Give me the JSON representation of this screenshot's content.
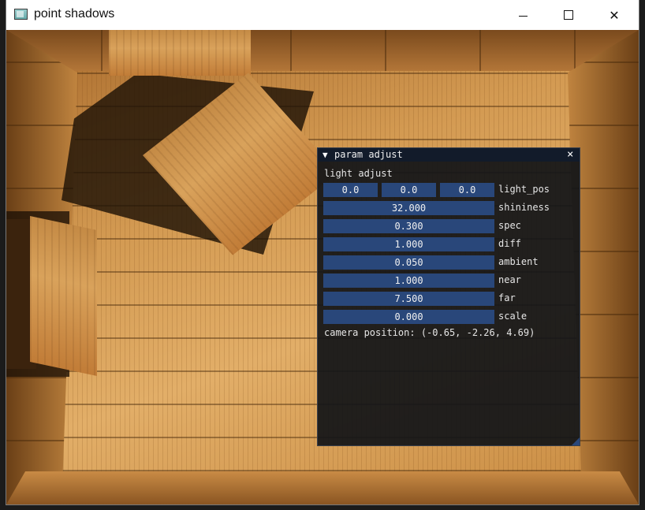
{
  "window": {
    "title": "point shadows",
    "controls": {
      "minimize": "minimize",
      "maximize": "maximize",
      "close": "close"
    }
  },
  "panel": {
    "title": "param adjust",
    "close_glyph": "×",
    "collapse_glyph": "▼",
    "section": "light adjust",
    "light_pos": {
      "values": [
        "0.0",
        "0.0",
        "0.0"
      ],
      "label": "light_pos"
    },
    "params": [
      {
        "value": "32.000",
        "label": "shininess"
      },
      {
        "value": "0.300",
        "label": "spec"
      },
      {
        "value": "1.000",
        "label": "diff"
      },
      {
        "value": "0.050",
        "label": "ambient"
      },
      {
        "value": "1.000",
        "label": "near"
      },
      {
        "value": "7.500",
        "label": "far"
      },
      {
        "value": "0.000",
        "label": "scale"
      }
    ],
    "camera_position": "camera position: (-0.65, -2.26, 4.69)",
    "colors": {
      "background": "#121418",
      "field": "#29477a",
      "header": "#121b2a"
    }
  }
}
